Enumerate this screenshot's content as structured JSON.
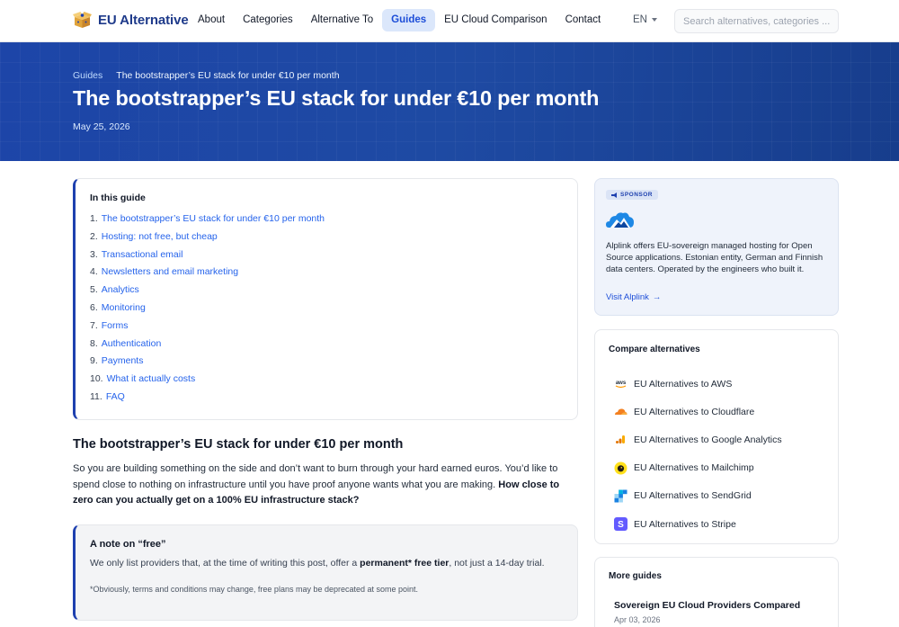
{
  "header": {
    "logo_text": "EU Alternative",
    "nav": [
      {
        "label": "About",
        "active": false
      },
      {
        "label": "Categories",
        "active": false
      },
      {
        "label": "Alternative To",
        "active": false
      },
      {
        "label": "Guides",
        "active": true
      },
      {
        "label": "EU Cloud Comparison",
        "active": false
      },
      {
        "label": "Contact",
        "active": false
      }
    ],
    "language": "EN",
    "search_placeholder": "Search alternatives, categories ..."
  },
  "hero": {
    "breadcrumb_root": "Guides",
    "breadcrumb_current": "The bootstrapper’s EU stack for under €10 per month",
    "title": "The bootstrapper’s EU stack for under €10 per month",
    "date": "May 25, 2026"
  },
  "toc": {
    "title": "In this guide",
    "items": [
      {
        "num": "1.",
        "label": "The bootstrapper’s EU stack for under €10 per month"
      },
      {
        "num": "2.",
        "label": "Hosting: not free, but cheap"
      },
      {
        "num": "3.",
        "label": "Transactional email"
      },
      {
        "num": "4.",
        "label": "Newsletters and email marketing"
      },
      {
        "num": "5.",
        "label": "Analytics"
      },
      {
        "num": "6.",
        "label": "Monitoring"
      },
      {
        "num": "7.",
        "label": "Forms"
      },
      {
        "num": "8.",
        "label": "Authentication"
      },
      {
        "num": "9.",
        "label": "Payments"
      },
      {
        "num": "10.",
        "label": "What it actually costs"
      },
      {
        "num": "11.",
        "label": "FAQ"
      }
    ]
  },
  "article": {
    "heading": "The bootstrapper’s EU stack for under €10 per month",
    "para_plain": "So you are building something on the side and don’t want to burn through your hard earned euros. You’d like to spend close to nothing on infrastructure until you have proof anyone wants what you are making. ",
    "para_bold": "How close to zero can you actually get on a 100% EU infrastructure stack?",
    "note": {
      "title": "A note on “free”",
      "text_before": "We only list providers that, at the time of writing this post, offer a ",
      "text_bold": "permanent* free tier",
      "text_after": ", not just a 14-day trial.",
      "small": "*Obviously, terms and conditions may change, free plans may be deprecated at some point."
    }
  },
  "sponsor": {
    "badge": "SPONSOR",
    "text": "Alplink offers EU-sovereign managed hosting for Open Source applications. Estonian entity, German and Finnish data centers. Operated by the engineers who built it.",
    "link": "Visit Alplink",
    "link_arrow": "→"
  },
  "compare": {
    "title": "Compare alternatives",
    "items": [
      {
        "label": "EU Alternatives to AWS",
        "icon": "aws-icon"
      },
      {
        "label": "EU Alternatives to Cloudflare",
        "icon": "cloudflare-icon"
      },
      {
        "label": "EU Alternatives to Google Analytics",
        "icon": "google-analytics-icon"
      },
      {
        "label": "EU Alternatives to Mailchimp",
        "icon": "mailchimp-icon"
      },
      {
        "label": "EU Alternatives to SendGrid",
        "icon": "sendgrid-icon"
      },
      {
        "label": "EU Alternatives to Stripe",
        "icon": "stripe-icon"
      }
    ],
    "aws_text": "aws",
    "stripe_letter": "S"
  },
  "more_guides": {
    "title": "More guides",
    "items": [
      {
        "title": "Sovereign EU Cloud Providers Compared",
        "date": "Apr 03, 2026"
      }
    ]
  },
  "colors": {
    "brand": "#1e3a8a",
    "link": "#2563eb",
    "hero": "#1d45a8"
  }
}
